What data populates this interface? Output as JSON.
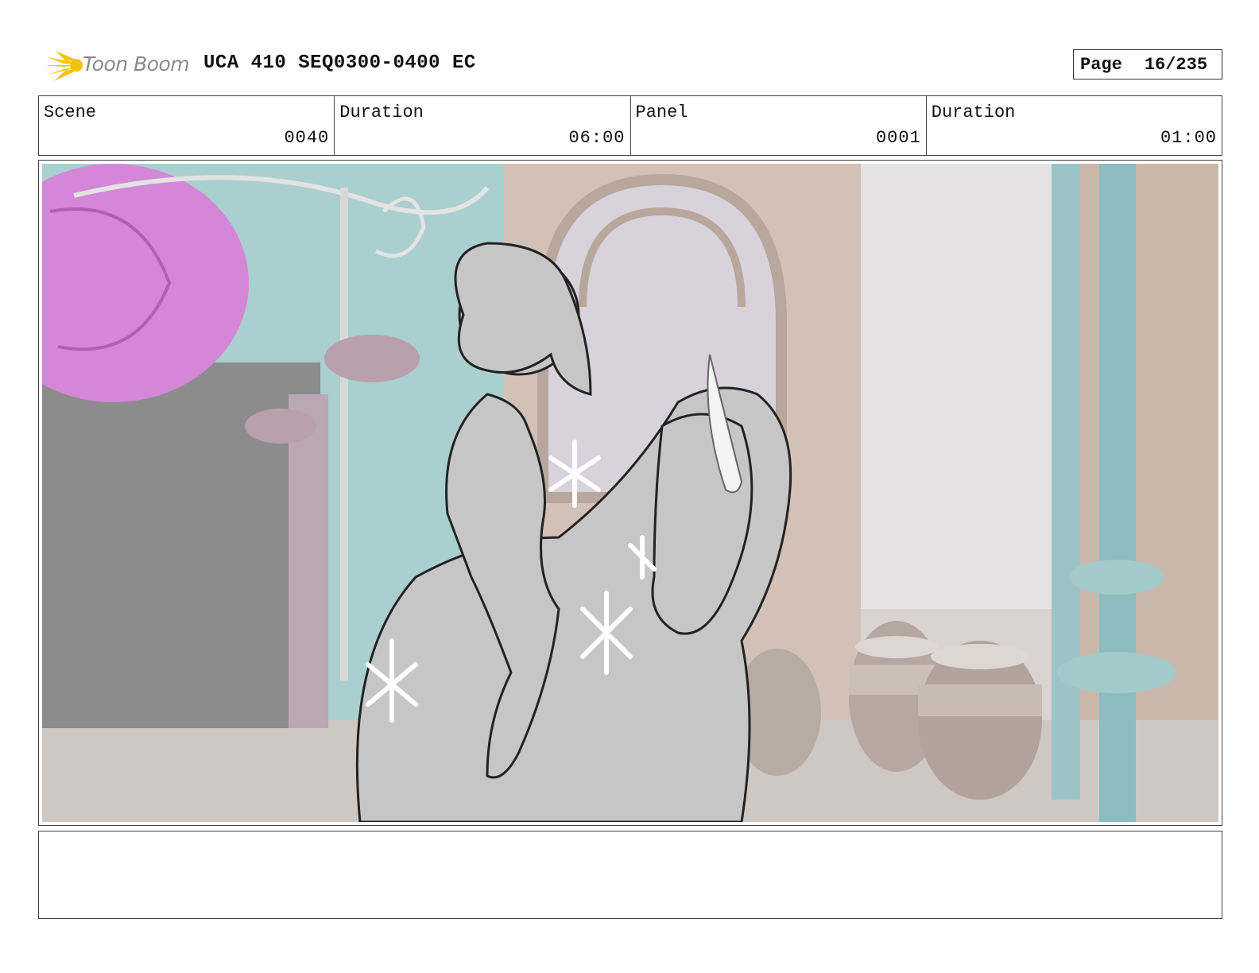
{
  "header": {
    "logo_text": "Toon Boom",
    "logo_icon": "sunburst-logo-icon",
    "title": "UCA 410 SEQ0300-0400 EC",
    "page_label": "Page",
    "page_number": "16/235"
  },
  "info": {
    "scene_label": "Scene",
    "scene_value": "0040",
    "duration_label": "Duration",
    "duration_value": "06:00",
    "panel_label": "Panel",
    "panel_value": "0001",
    "panel_duration_label": "Duration",
    "panel_duration_value": "01:00"
  },
  "panel": {
    "image_icon": "storyboard-sketch-image"
  },
  "notes": {
    "text": ""
  },
  "colors": {
    "logo_yellow": "#f5c400",
    "logo_gray": "#8a8a8a",
    "wall_teal": "#9fc6c7",
    "magenta_disc": "#d487d6"
  }
}
